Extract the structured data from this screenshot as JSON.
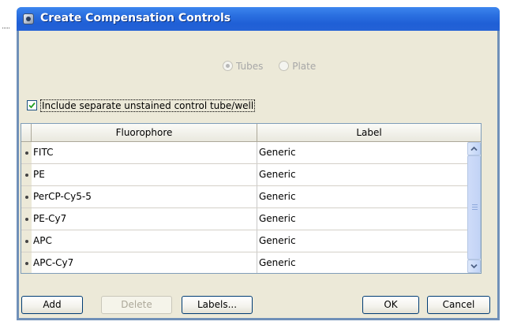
{
  "window": {
    "title": "Create Compensation Controls"
  },
  "mode": {
    "options": [
      {
        "label": "Tubes",
        "selected": true,
        "enabled": false
      },
      {
        "label": "Plate",
        "selected": false,
        "enabled": false
      }
    ]
  },
  "include_unstained": {
    "label": "Include separate unstained control tube/well",
    "checked": true
  },
  "table": {
    "columns": [
      "Fluorophore",
      "Label"
    ],
    "rows": [
      {
        "fluorophore": "FITC",
        "label": "Generic"
      },
      {
        "fluorophore": "PE",
        "label": "Generic"
      },
      {
        "fluorophore": "PerCP-Cy5-5",
        "label": "Generic"
      },
      {
        "fluorophore": "PE-Cy7",
        "label": "Generic"
      },
      {
        "fluorophore": "APC",
        "label": "Generic"
      },
      {
        "fluorophore": "APC-Cy7",
        "label": "Generic"
      }
    ]
  },
  "buttons": {
    "add": "Add",
    "delete": "Delete",
    "labels": "Labels...",
    "ok": "OK",
    "cancel": "Cancel"
  },
  "colors": {
    "titlebar": "#2462d6",
    "dialog_background": "#ece9d8",
    "button_border": "#003c74"
  }
}
